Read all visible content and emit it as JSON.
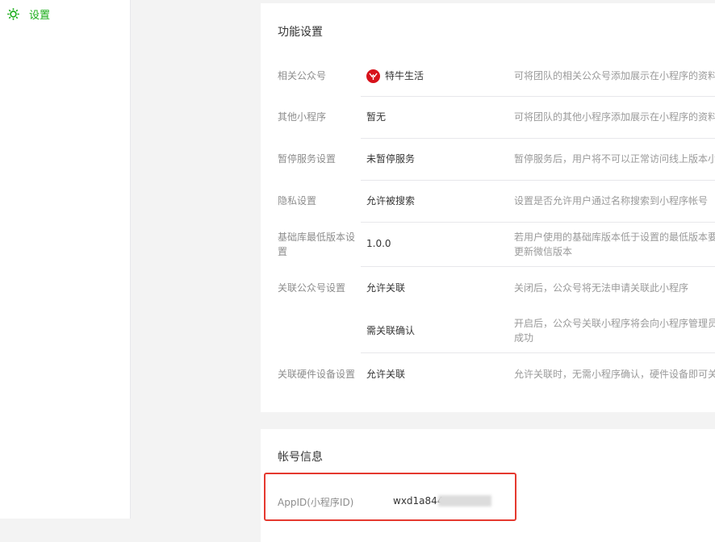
{
  "sidebar": {
    "items": [
      {
        "label": "设置",
        "icon": "gear-icon",
        "color": "#1aad19"
      }
    ]
  },
  "function_settings": {
    "title": "功能设置",
    "rows": [
      {
        "label": "相关公众号",
        "value": "特牛生活",
        "value_icon": "brand-avatar-icon",
        "desc": [
          "可将团队的相关公众号添加展示在小程序的资料"
        ]
      },
      {
        "label": "其他小程序",
        "value": "暂无",
        "desc": [
          "可将团队的其他小程序添加展示在小程序的资料"
        ]
      },
      {
        "label": "暂停服务设置",
        "value": "未暂停服务",
        "desc": [
          "暂停服务后，用户将不可以正常访问线上版本小"
        ]
      },
      {
        "label": "隐私设置",
        "value": "允许被搜索",
        "desc": [
          "设置是否允许用户通过名称搜索到小程序帐号"
        ]
      },
      {
        "label": "基础库最低版本设置",
        "value": "1.0.0",
        "desc": [
          "若用户使用的基础库版本低于设置的最低版本要",
          "更新微信版本"
        ]
      },
      {
        "label": "关联公众号设置",
        "value": "允许关联",
        "desc": [
          "关闭后，公众号将无法申请关联此小程序"
        ]
      },
      {
        "label": "",
        "value": "需关联确认",
        "desc": [
          "开启后，公众号关联小程序将会向小程序管理员",
          "成功"
        ]
      },
      {
        "label": "关联硬件设备设置",
        "value": "允许关联",
        "desc": [
          "允许关联时，无需小程序确认，硬件设备即可关"
        ]
      }
    ]
  },
  "account_info": {
    "title": "帐号信息",
    "appid_label": "AppID(小程序ID)",
    "appid_value": "wxd1a844"
  },
  "colors": {
    "accent": "#1aad19",
    "highlight": "#e5392f",
    "avatar": "#d7121b"
  }
}
